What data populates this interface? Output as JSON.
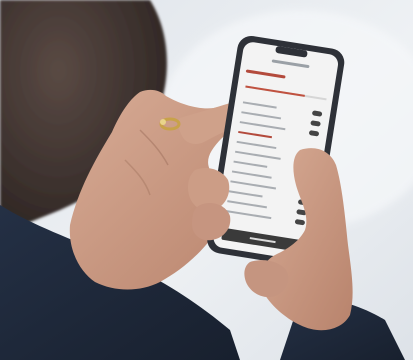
{
  "photo": {
    "subject": "hand-using-smartphone",
    "colors": {
      "background": "#e8ecf0",
      "skin": "#c99a84",
      "sleeve": "#2b3548",
      "phone_body": "#2e3138",
      "screen": "#f3f3f3",
      "accent_slider": "#c0513f",
      "button_bar": "#3a3a3a",
      "ring": "#c8a24a"
    }
  }
}
